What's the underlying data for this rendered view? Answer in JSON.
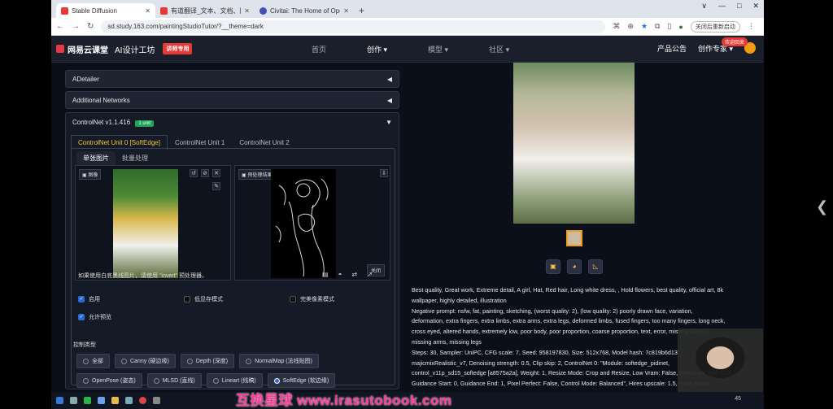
{
  "browser": {
    "tabs": [
      {
        "title": "Stable Diffusion",
        "color": "#e53935"
      },
      {
        "title": "有道翻译_文本、文档、网页、...",
        "color": "#e53935"
      },
      {
        "title": "Civitai: The Home of Open S...",
        "color": "#3f51b5"
      }
    ],
    "new_tab": "+",
    "window": [
      "∨",
      "—",
      "□",
      "✕"
    ],
    "back": "←",
    "forward": "→",
    "reload": "↻",
    "url": "sd.study.163.com/paintingStudioTutor/?__theme=dark",
    "relaunch": "关闭后重新启动"
  },
  "site": {
    "brand": "网易云课堂",
    "product": "AI设计工坊",
    "badge": "讲师专用",
    "nav": [
      "首页",
      "创作 ▾",
      "模型 ▾",
      "社区 ▾"
    ],
    "announce": "产品公告",
    "creator": "创作专家 ▾",
    "pill": "欢迎回来"
  },
  "accordions": [
    {
      "label": "ADetailer",
      "arrow": "◀"
    },
    {
      "label": "Additional Networks",
      "arrow": "◀"
    }
  ],
  "controlnet": {
    "title": "ControlNet v1.1.416",
    "units_badge": "1 unit",
    "arrow": "▼",
    "unit_tabs": [
      "ControlNet Unit 0 [SoftEdge]",
      "ControlNet Unit 1",
      "ControlNet Unit 2"
    ],
    "sub_tabs": [
      "单张图片",
      "批量处理"
    ],
    "image_label": "图像",
    "preview_label": "预处理结果预览",
    "close_label": "关闭",
    "hint": "如果使用白底黑线图片，请使用 \"invert\" 预处理器。",
    "options": [
      {
        "label": "启用",
        "checked": true
      },
      {
        "label": "低显存模式",
        "checked": false
      },
      {
        "label": "完美像素模式",
        "checked": false
      },
      {
        "label": "允许预览",
        "checked": true
      }
    ],
    "control_type_label": "控制类型",
    "types_row1": [
      "全部",
      "Canny (硬边缘)",
      "Depth (深度)",
      "NormalMap (法线贴图)"
    ],
    "types_row2": [
      "OpenPose (姿态)",
      "MLSD (直线)",
      "Lineart (线稿)",
      "SoftEdge (软边缘)"
    ],
    "selected_type": "SoftEdge (软边缘)"
  },
  "output": {
    "info_lines": [
      "Best quality, Great work, Extreme detail, A girl, Hat, Red hair, Long white dress, , Hold flowers, best quality, official art, 8k",
      "wallpaper, highly detailed, illustration",
      "Negative prompt: nsfw, fat, painting, sketching, (worst quality: 2), (low quality: 2) poorly drawn face, variation,",
      "deformation, extra fingers, extra limbs, extra arms, extra legs, deformed limbs, fused fingers, too many fingers, long neck,",
      "cross eyed, altered hands, extremely low, poor body, poor proportion, coarse proportion, text, error, missing fingers,",
      "missing arms, missing legs",
      "Steps: 30, Sampler: UniPC, CFG scale: 7, Seed: 958197830, Size: 512x768, Model hash: 7c819b6d13,",
      "majicmixRealistic_v7, Denoising strength: 0.5, Clip skip: 2, ControlNet 0: \"Module: softedge_pidinet,",
      "control_v11p_sd15_softedge [a8575a2a], Weight: 1, Resize Mode: Crop and Resize, Low Vram: False, Processor Res: 512,",
      "Guidance Start: 0, Guidance End: 1, Pixel Perfect: False, Control Mode: Balanced\", Hires upscale: 1.5, Hires steps: ..."
    ]
  },
  "taskbar": {
    "time": "45"
  },
  "watermark": "互换星球 www.irasutobook.com"
}
